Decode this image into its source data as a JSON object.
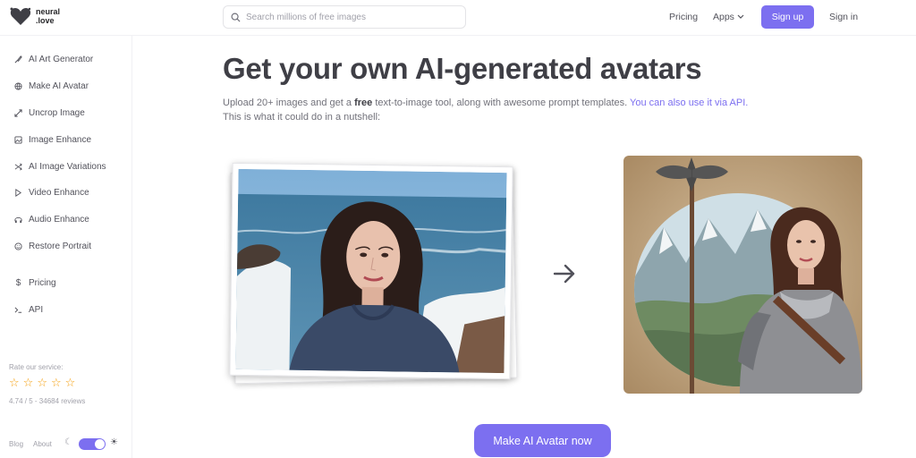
{
  "header": {
    "logo_line1": "neural",
    "logo_line2": ".love",
    "search_placeholder": "Search millions of free images",
    "nav_pricing": "Pricing",
    "nav_apps": "Apps",
    "signup_label": "Sign up",
    "signin_label": "Sign in"
  },
  "sidebar": {
    "items": [
      {
        "label": "AI Art Generator",
        "icon": "brush-icon"
      },
      {
        "label": "Make AI Avatar",
        "icon": "globe-icon"
      },
      {
        "label": "Uncrop Image",
        "icon": "expand-icon"
      },
      {
        "label": "Image Enhance",
        "icon": "image-icon"
      },
      {
        "label": "AI Image Variations",
        "icon": "shuffle-icon"
      },
      {
        "label": "Video Enhance",
        "icon": "play-icon"
      },
      {
        "label": "Audio Enhance",
        "icon": "headphones-icon"
      },
      {
        "label": "Restore Portrait",
        "icon": "smile-icon"
      },
      {
        "label": "Pricing",
        "icon": "dollar-icon"
      },
      {
        "label": "API",
        "icon": "terminal-icon"
      }
    ],
    "rate_title": "Rate our service:",
    "rating_text": "4.74 / 5 - 34684 reviews",
    "rating_value": 4.74,
    "footer_blog": "Blog",
    "footer_about": "About"
  },
  "main": {
    "title": "Get your own AI-generated avatars",
    "desc_part1": "Upload 20+ images and get a ",
    "desc_bold": "free",
    "desc_part2": " text-to-image tool, along with awesome prompt templates. ",
    "desc_link": "You can also use it via API.",
    "desc_line2": "This is what it could do in a nutshell:",
    "cta_label": "Make AI Avatar now"
  },
  "colors": {
    "accent": "#7c6ff0",
    "star": "#f59e0b"
  }
}
